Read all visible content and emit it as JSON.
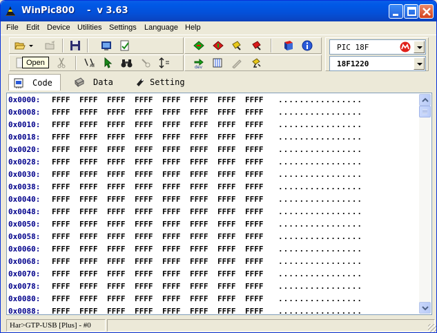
{
  "window": {
    "title": "WinPic800    -  v 3.63",
    "icon": "wizard-hat-icon",
    "buttons": [
      "minimize",
      "maximize",
      "close"
    ]
  },
  "menu": [
    "File",
    "Edit",
    "Device",
    "Utilities",
    "Settings",
    "Language",
    "Help"
  ],
  "toolbar": {
    "row1_left": [
      "open-icon",
      "open-dropdown-icon",
      "reload-icon",
      "save-icon",
      "hex-view-icon",
      "check-icon"
    ],
    "row1_right": [
      "read-chip-icon",
      "write-chip-icon",
      "verify-chip-icon",
      "erase-chip-icon",
      "book-icon",
      "info-icon"
    ],
    "row2_left": [
      "new-icon",
      "cut-icon",
      "binoculars-icon"
    ],
    "row2_right": [
      "detect-device-icon",
      "code-view-icon"
    ],
    "tooltip": "Open"
  },
  "device": {
    "family": "PIC 18F",
    "model": "18F1220",
    "brand_icon": "microchip-logo-icon"
  },
  "tabs": [
    {
      "label": "Code",
      "icon": "chip-code-icon",
      "active": true
    },
    {
      "label": "Data",
      "icon": "chip-data-icon",
      "active": false
    },
    {
      "label": "Setting",
      "icon": "setting-icon",
      "active": false
    }
  ],
  "code": {
    "rows": [
      {
        "addr": "0x0000:",
        "words": [
          "FFFF",
          "FFFF",
          "FFFF",
          "FFFF",
          "FFFF",
          "FFFF",
          "FFFF",
          "FFFF"
        ],
        "ascii": "................"
      },
      {
        "addr": "0x0008:",
        "words": [
          "FFFF",
          "FFFF",
          "FFFF",
          "FFFF",
          "FFFF",
          "FFFF",
          "FFFF",
          "FFFF"
        ],
        "ascii": "................"
      },
      {
        "addr": "0x0010:",
        "words": [
          "FFFF",
          "FFFF",
          "FFFF",
          "FFFF",
          "FFFF",
          "FFFF",
          "FFFF",
          "FFFF"
        ],
        "ascii": "................"
      },
      {
        "addr": "0x0018:",
        "words": [
          "FFFF",
          "FFFF",
          "FFFF",
          "FFFF",
          "FFFF",
          "FFFF",
          "FFFF",
          "FFFF"
        ],
        "ascii": "................"
      },
      {
        "addr": "0x0020:",
        "words": [
          "FFFF",
          "FFFF",
          "FFFF",
          "FFFF",
          "FFFF",
          "FFFF",
          "FFFF",
          "FFFF"
        ],
        "ascii": "................"
      },
      {
        "addr": "0x0028:",
        "words": [
          "FFFF",
          "FFFF",
          "FFFF",
          "FFFF",
          "FFFF",
          "FFFF",
          "FFFF",
          "FFFF"
        ],
        "ascii": "................"
      },
      {
        "addr": "0x0030:",
        "words": [
          "FFFF",
          "FFFF",
          "FFFF",
          "FFFF",
          "FFFF",
          "FFFF",
          "FFFF",
          "FFFF"
        ],
        "ascii": "................"
      },
      {
        "addr": "0x0038:",
        "words": [
          "FFFF",
          "FFFF",
          "FFFF",
          "FFFF",
          "FFFF",
          "FFFF",
          "FFFF",
          "FFFF"
        ],
        "ascii": "................"
      },
      {
        "addr": "0x0040:",
        "words": [
          "FFFF",
          "FFFF",
          "FFFF",
          "FFFF",
          "FFFF",
          "FFFF",
          "FFFF",
          "FFFF"
        ],
        "ascii": "................"
      },
      {
        "addr": "0x0048:",
        "words": [
          "FFFF",
          "FFFF",
          "FFFF",
          "FFFF",
          "FFFF",
          "FFFF",
          "FFFF",
          "FFFF"
        ],
        "ascii": "................"
      },
      {
        "addr": "0x0050:",
        "words": [
          "FFFF",
          "FFFF",
          "FFFF",
          "FFFF",
          "FFFF",
          "FFFF",
          "FFFF",
          "FFFF"
        ],
        "ascii": "................"
      },
      {
        "addr": "0x0058:",
        "words": [
          "FFFF",
          "FFFF",
          "FFFF",
          "FFFF",
          "FFFF",
          "FFFF",
          "FFFF",
          "FFFF"
        ],
        "ascii": "................"
      },
      {
        "addr": "0x0060:",
        "words": [
          "FFFF",
          "FFFF",
          "FFFF",
          "FFFF",
          "FFFF",
          "FFFF",
          "FFFF",
          "FFFF"
        ],
        "ascii": "................"
      },
      {
        "addr": "0x0068:",
        "words": [
          "FFFF",
          "FFFF",
          "FFFF",
          "FFFF",
          "FFFF",
          "FFFF",
          "FFFF",
          "FFFF"
        ],
        "ascii": "................"
      },
      {
        "addr": "0x0070:",
        "words": [
          "FFFF",
          "FFFF",
          "FFFF",
          "FFFF",
          "FFFF",
          "FFFF",
          "FFFF",
          "FFFF"
        ],
        "ascii": "................"
      },
      {
        "addr": "0x0078:",
        "words": [
          "FFFF",
          "FFFF",
          "FFFF",
          "FFFF",
          "FFFF",
          "FFFF",
          "FFFF",
          "FFFF"
        ],
        "ascii": "................"
      },
      {
        "addr": "0x0080:",
        "words": [
          "FFFF",
          "FFFF",
          "FFFF",
          "FFFF",
          "FFFF",
          "FFFF",
          "FFFF",
          "FFFF"
        ],
        "ascii": "................"
      },
      {
        "addr": "0x0088:",
        "words": [
          "FFFF",
          "FFFF",
          "FFFF",
          "FFFF",
          "FFFF",
          "FFFF",
          "FFFF",
          "FFFF"
        ],
        "ascii": "................"
      }
    ]
  },
  "status": {
    "hardware": "Har>GTP-USB [Plus] - #0",
    "right": ""
  },
  "colors": {
    "titlebar": "#0058e6",
    "address": "#00008b",
    "face": "#ece9d8"
  }
}
